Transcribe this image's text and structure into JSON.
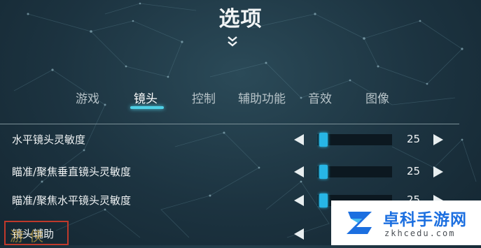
{
  "header": {
    "title": "选项"
  },
  "tabs": [
    {
      "label": "游戏",
      "active": false
    },
    {
      "label": "镜头",
      "active": true
    },
    {
      "label": "控制",
      "active": false
    },
    {
      "label": "辅助功能",
      "active": false
    },
    {
      "label": "音效",
      "active": false
    },
    {
      "label": "图像",
      "active": false
    }
  ],
  "settings": [
    {
      "label": "水平镜头灵敏度",
      "value": "25"
    },
    {
      "label": "瞄准/聚焦垂直镜头灵敏度",
      "value": "25"
    },
    {
      "label": "瞄准/聚焦水平镜头灵敏度",
      "value": "25"
    },
    {
      "label": "镜头辅助"
    }
  ],
  "slider_fill_fraction": 0.0,
  "watermark_left": {
    "text": "游侠"
  },
  "brand": {
    "name": "卓科手游网",
    "url": "zkhcedu.com"
  },
  "colors": {
    "accent": "#4fd0e6",
    "thumb": "#27b6e6",
    "brand_blue": "#1c6fe0",
    "watermark_border": "#c0392b"
  },
  "icons": {
    "collapse": "double-chevron-down-icon",
    "decrease": "triangle-left-icon",
    "increase": "triangle-right-icon"
  }
}
